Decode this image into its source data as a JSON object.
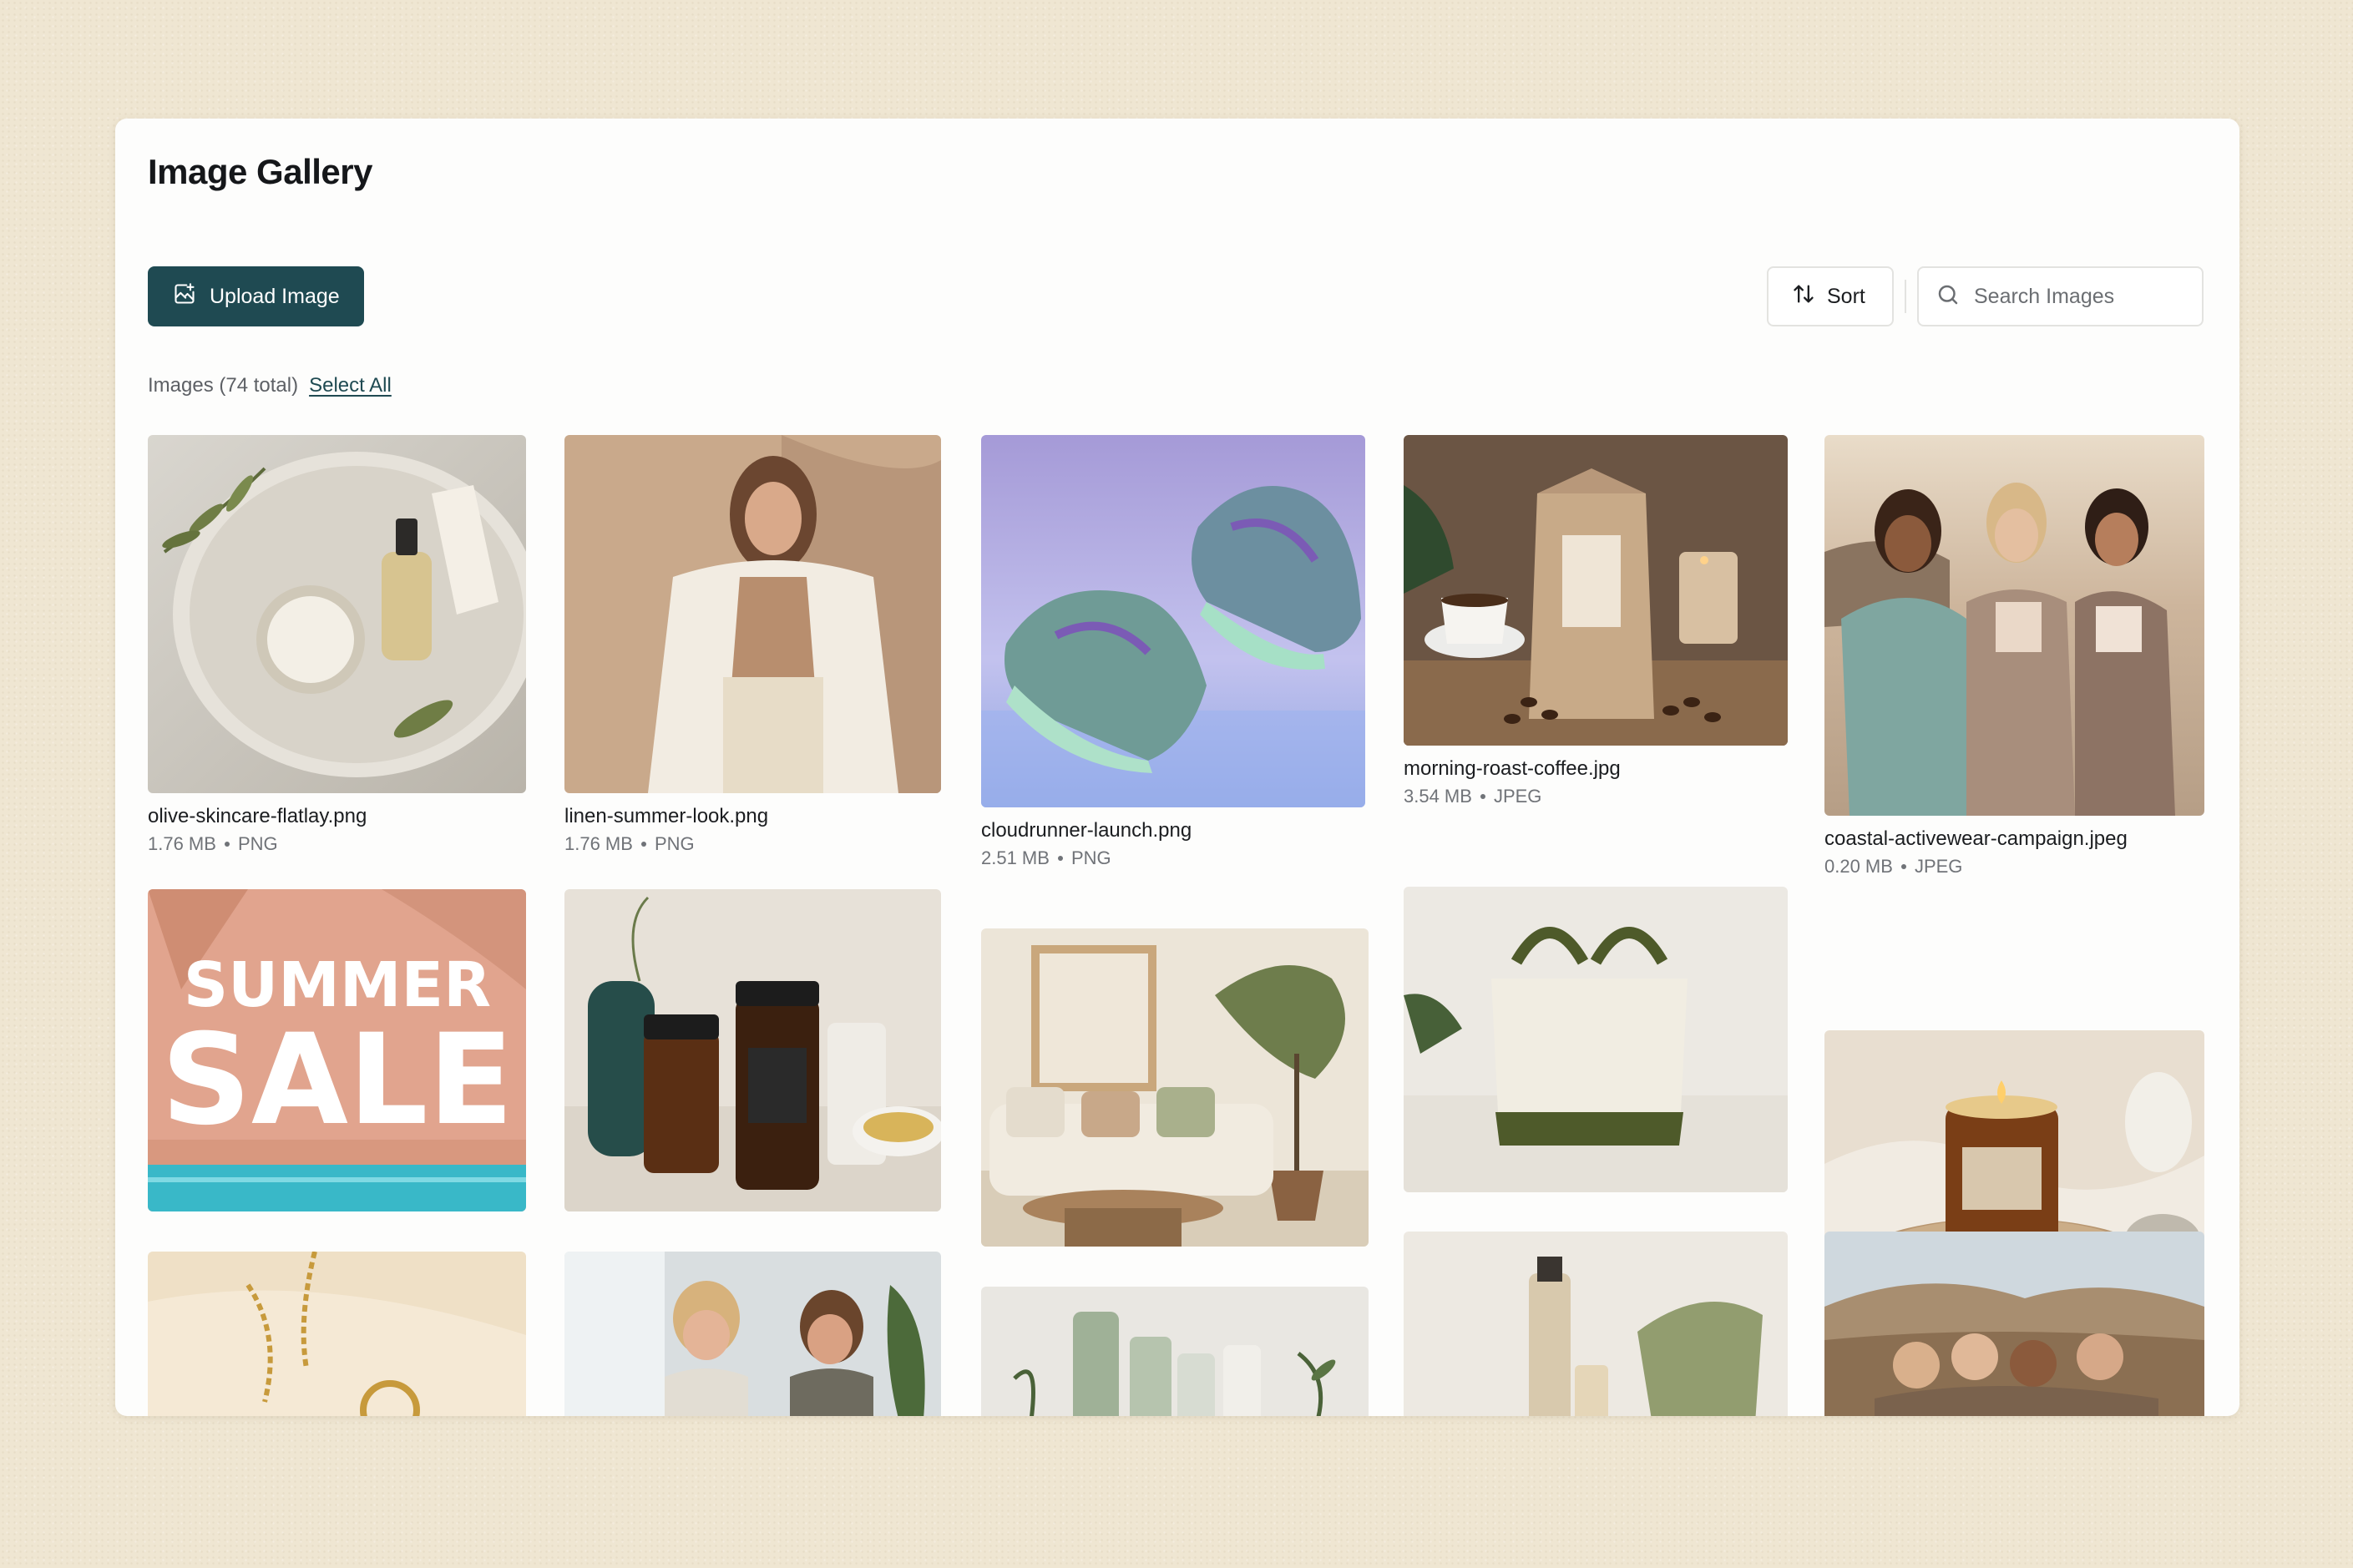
{
  "page": {
    "title": "Image Gallery",
    "upload_label": "Upload Image",
    "sort_label": "Sort",
    "search_placeholder": "Search Images",
    "count_label": "Images (74 total)",
    "select_all_label": "Select All"
  },
  "images": [
    {
      "name": "olive-skincare-flatlay.png",
      "size": "1.76 MB",
      "type": "PNG"
    },
    {
      "name": "linen-summer-look.png",
      "size": "1.76 MB",
      "type": "PNG"
    },
    {
      "name": "cloudrunner-launch.png",
      "size": "2.51 MB",
      "type": "PNG"
    },
    {
      "name": "morning-roast-coffee.jpg",
      "size": "3.54 MB",
      "type": "JPEG"
    },
    {
      "name": "coastal-activewear-campaign.jpeg",
      "size": "0.20 MB",
      "type": "JPEG"
    }
  ],
  "summer_sale": {
    "line1": "SUMMER",
    "line2": "SALE"
  },
  "colors": {
    "accent": "#1f4a52",
    "background": "#efe6d2"
  }
}
